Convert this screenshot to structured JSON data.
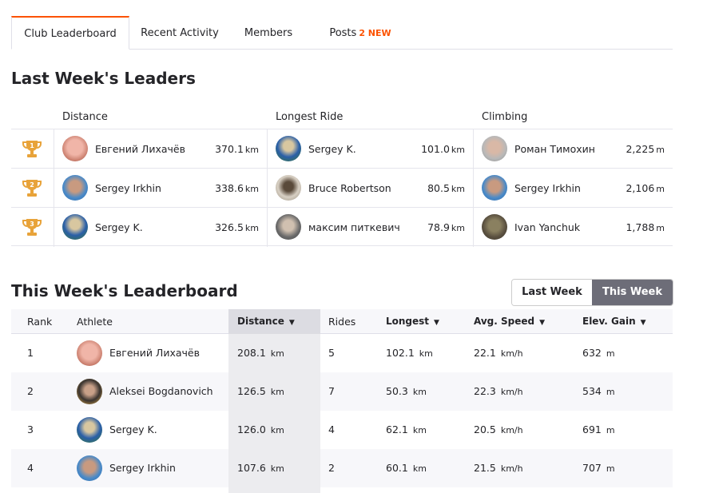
{
  "tabs": [
    {
      "label": "Club Leaderboard"
    },
    {
      "label": "Recent Activity"
    },
    {
      "label": "Members"
    },
    {
      "label": "Posts",
      "badge": "2 NEW"
    }
  ],
  "last_week": {
    "title": "Last Week's Leaders",
    "columns": [
      "Distance",
      "Longest Ride",
      "Climbing"
    ],
    "rows": [
      {
        "rank": "1",
        "distance": {
          "name": "Евгений Лихачёв",
          "value": "370.1",
          "unit": "km"
        },
        "longest": {
          "name": "Sergey K.",
          "value": "101.0",
          "unit": "km"
        },
        "climbing": {
          "name": "Роман Тимохин",
          "value": "2,225",
          "unit": "m"
        }
      },
      {
        "rank": "2",
        "distance": {
          "name": "Sergey Irkhin",
          "value": "338.6",
          "unit": "km"
        },
        "longest": {
          "name": "Bruce Robertson",
          "value": "80.5",
          "unit": "km"
        },
        "climbing": {
          "name": "Sergey Irkhin",
          "value": "2,106",
          "unit": "m"
        }
      },
      {
        "rank": "3",
        "distance": {
          "name": "Sergey K.",
          "value": "326.5",
          "unit": "km"
        },
        "longest": {
          "name": "максим питкевич",
          "value": "78.9",
          "unit": "km"
        },
        "climbing": {
          "name": "Ivan Yanchuk",
          "value": "1,788",
          "unit": "m"
        }
      }
    ]
  },
  "this_week": {
    "title": "This Week's Leaderboard",
    "toggle": {
      "last_week": "Last Week",
      "this_week": "This Week",
      "selected": "This Week"
    },
    "headers": {
      "rank": "Rank",
      "athlete": "Athlete",
      "distance": "Distance",
      "rides": "Rides",
      "longest": "Longest",
      "speed": "Avg. Speed",
      "elev": "Elev. Gain"
    },
    "sort_caret": "▼",
    "rows": [
      {
        "rank": "1",
        "athlete": "Евгений Лихачёв",
        "distance": "208.1",
        "rides": "5",
        "longest": "102.1",
        "speed": "22.1",
        "elev": "632"
      },
      {
        "rank": "2",
        "athlete": "Aleksei Bogdanovich",
        "distance": "126.5",
        "rides": "7",
        "longest": "50.3",
        "speed": "22.3",
        "elev": "534"
      },
      {
        "rank": "3",
        "athlete": "Sergey K.",
        "distance": "126.0",
        "rides": "4",
        "longest": "62.1",
        "speed": "20.5",
        "elev": "691"
      },
      {
        "rank": "4",
        "athlete": "Sergey Irkhin",
        "distance": "107.6",
        "rides": "2",
        "longest": "60.1",
        "speed": "21.5",
        "elev": "707"
      }
    ],
    "units": {
      "distance": "km",
      "longest": "km",
      "speed": "km/h",
      "elev": "m"
    }
  },
  "colors": {
    "brand": "#fc5200",
    "trophy": "#e8a33a",
    "toggle_active": "#6d6d78"
  }
}
